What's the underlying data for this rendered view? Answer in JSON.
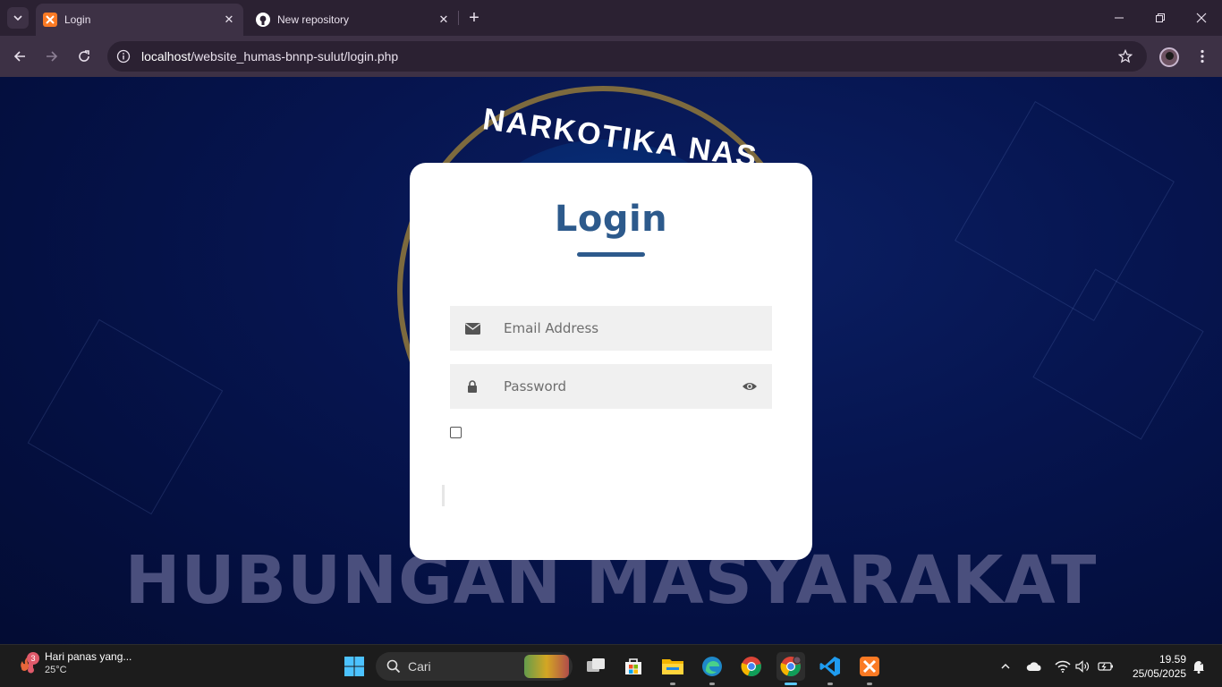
{
  "browser": {
    "tabs": [
      {
        "title": "Login",
        "active": true,
        "favicon": "xampp-icon"
      },
      {
        "title": "New repository",
        "active": false,
        "favicon": "github-icon"
      }
    ],
    "url_host": "localhost",
    "url_path": "/website_humas-bnnp-sulut/login.php"
  },
  "background": {
    "emblem_text": "NARKOTIKA NAS",
    "heading": "HUBUNGAN MASYARAKAT"
  },
  "login": {
    "title": "Login",
    "email_placeholder": "Email Address",
    "password_placeholder": "Password",
    "remember_checked": false,
    "colors": {
      "accent": "#2d5a8c",
      "field_bg": "#f0f0f0"
    }
  },
  "taskbar": {
    "weather_badge": "3",
    "weather_text": "Hari panas yang...",
    "temperature": "25°C",
    "search_placeholder": "Cari",
    "time": "19.59",
    "date": "25/05/2025",
    "pinned": [
      "task-view",
      "microsoft-store",
      "file-explorer",
      "edge",
      "chrome",
      "chrome-profile",
      "vscode",
      "xampp"
    ]
  }
}
